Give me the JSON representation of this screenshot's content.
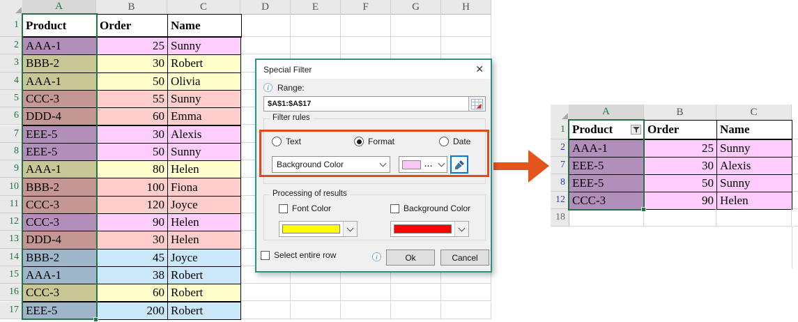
{
  "left_sheet": {
    "column_letters": [
      "A",
      "B",
      "C",
      "D",
      "E",
      "F",
      "G",
      "H"
    ],
    "row_numbers": [
      "1",
      "2",
      "3",
      "4",
      "5",
      "6",
      "7",
      "8",
      "9",
      "10",
      "11",
      "12",
      "13",
      "14",
      "15",
      "16",
      "17"
    ],
    "header_row": {
      "product": "Product",
      "order": "Order",
      "name": "Name"
    },
    "rows": [
      {
        "num": "2",
        "product": "AAA-1",
        "order": "25",
        "name": "Sunny",
        "color": "pink"
      },
      {
        "num": "3",
        "product": "BBB-2",
        "order": "30",
        "name": "Robert",
        "color": "yellow"
      },
      {
        "num": "4",
        "product": "AAA-1",
        "order": "50",
        "name": "Olivia",
        "color": "yellow"
      },
      {
        "num": "5",
        "product": "CCC-3",
        "order": "55",
        "name": "Sunny",
        "color": "salmon"
      },
      {
        "num": "6",
        "product": "DDD-4",
        "order": "60",
        "name": "Emma",
        "color": "salmon"
      },
      {
        "num": "7",
        "product": "EEE-5",
        "order": "30",
        "name": "Alexis",
        "color": "pink"
      },
      {
        "num": "8",
        "product": "EEE-5",
        "order": "50",
        "name": "Sunny",
        "color": "pink"
      },
      {
        "num": "9",
        "product": "AAA-1",
        "order": "80",
        "name": "Helen",
        "color": "yellow"
      },
      {
        "num": "10",
        "product": "BBB-2",
        "order": "100",
        "name": "Fiona",
        "color": "salmon"
      },
      {
        "num": "11",
        "product": "CCC-3",
        "order": "120",
        "name": "Joyce",
        "color": "salmon"
      },
      {
        "num": "12",
        "product": "CCC-3",
        "order": "90",
        "name": "Helen",
        "color": "pink"
      },
      {
        "num": "13",
        "product": "DDD-4",
        "order": "30",
        "name": "Helen",
        "color": "salmon"
      },
      {
        "num": "14",
        "product": "BBB-2",
        "order": "45",
        "name": "Joyce",
        "color": "blue"
      },
      {
        "num": "15",
        "product": "AAA-1",
        "order": "38",
        "name": "Robert",
        "color": "blue"
      },
      {
        "num": "16",
        "product": "CCC-3",
        "order": "60",
        "name": "Robert",
        "color": "yellow"
      },
      {
        "num": "17",
        "product": "EEE-5",
        "order": "200",
        "name": "Robert",
        "color": "blue"
      }
    ]
  },
  "dialog": {
    "title": "Special Filter",
    "close_glyph": "✕",
    "info_glyph": "i",
    "range_label": "Range:",
    "range_value": "$A$1:$A$17",
    "filter_rules_label": "Filter rules",
    "radios": {
      "text": "Text",
      "format": "Format",
      "date": "Date",
      "selected": "Format"
    },
    "criteria_value": "Background Color",
    "color_dots": "...",
    "processing_label": "Processing of results",
    "font_color_label": "Font Color",
    "background_color_label": "Background Color",
    "select_entire_row_label": "Select entire row",
    "ok_label": "Ok",
    "cancel_label": "Cancel"
  },
  "right_sheet": {
    "column_letters": [
      "A",
      "B",
      "C"
    ],
    "header_row": {
      "product": "Product",
      "order": "Order",
      "name": "Name"
    },
    "rows": [
      {
        "num": "2",
        "product": "AAA-1",
        "order": "25",
        "name": "Sunny"
      },
      {
        "num": "7",
        "product": "EEE-5",
        "order": "30",
        "name": "Alexis"
      },
      {
        "num": "8",
        "product": "EEE-5",
        "order": "50",
        "name": "Sunny"
      },
      {
        "num": "12",
        "product": "CCC-3",
        "order": "90",
        "name": "Helen"
      }
    ],
    "trailing_row_number": "18"
  },
  "colors": {
    "excel_green": "#217346",
    "filtered_number_blue": "#2B3CC4",
    "highlight_orange": "#E04A17",
    "arrow_orange": "#E2561E",
    "dialog_border_teal": "#2A9184",
    "filter_swatch_pink": "#FAC7F4",
    "font_swatch_yellow": "#FFFF00",
    "background_swatch_red": "#FF0000",
    "cell_colors": {
      "pink": {
        "a": "#B28FBA",
        "bc": "#FFCCFE"
      },
      "yellow": {
        "a": "#C8C695",
        "bc": "#FFFFCC"
      },
      "salmon": {
        "a": "#C49694",
        "bc": "#FFCDCB"
      },
      "blue": {
        "a": "#9FB6CA",
        "bc": "#CBE8FA"
      }
    }
  }
}
